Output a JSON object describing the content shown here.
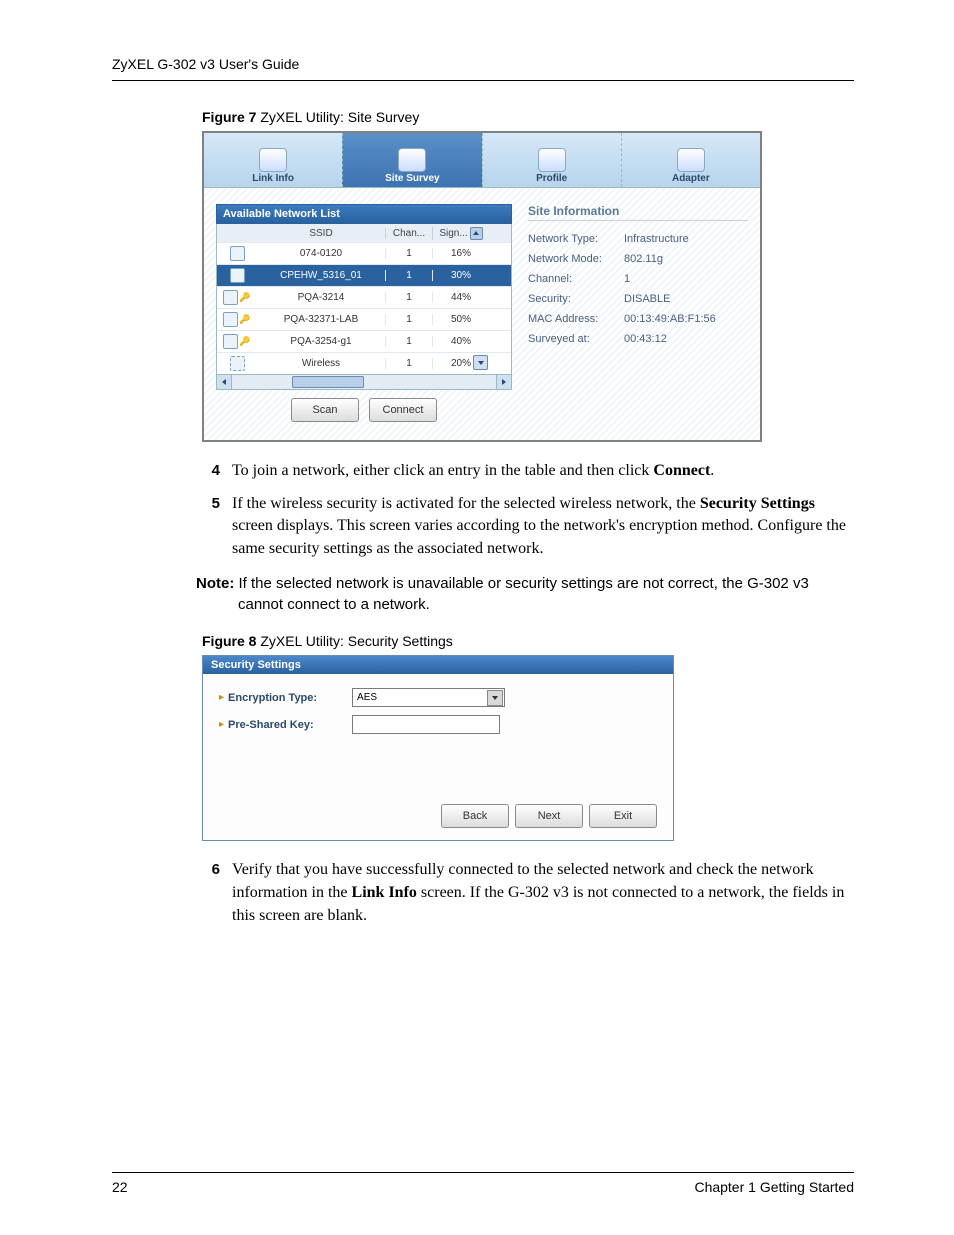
{
  "header": "ZyXEL G-302 v3 User's Guide",
  "figure7": {
    "caption_bold": "Figure 7",
    "caption_rest": "   ZyXEL Utility: Site Survey",
    "tabs": [
      "Link Info",
      "Site Survey",
      "Profile",
      "Adapter"
    ],
    "list_title": "Available Network List",
    "cols": {
      "ssid": "SSID",
      "chan": "Chan...",
      "sig": "Sign..."
    },
    "rows": [
      {
        "ssid": "074-0120",
        "chan": "1",
        "sig": "16%",
        "lock": false,
        "ad": false
      },
      {
        "ssid": "CPEHW_5316_01",
        "chan": "1",
        "sig": "30%",
        "lock": false,
        "ad": false,
        "sel": true
      },
      {
        "ssid": "PQA-3214",
        "chan": "1",
        "sig": "44%",
        "lock": true,
        "ad": false
      },
      {
        "ssid": "PQA-32371-LAB",
        "chan": "1",
        "sig": "50%",
        "lock": true,
        "ad": false
      },
      {
        "ssid": "PQA-3254-g1",
        "chan": "1",
        "sig": "40%",
        "lock": true,
        "ad": false
      },
      {
        "ssid": "Wireless",
        "chan": "1",
        "sig": "20%",
        "lock": false,
        "ad": true
      }
    ],
    "scan": "Scan",
    "connect": "Connect",
    "site_title": "Site Information",
    "site": [
      {
        "l": "Network Type:",
        "v": "Infrastructure"
      },
      {
        "l": "Network Mode:",
        "v": "802.11g"
      },
      {
        "l": "Channel:",
        "v": "1"
      },
      {
        "l": "Security:",
        "v": "DISABLE"
      },
      {
        "l": "MAC Address:",
        "v": "00:13:49:AB:F1:56"
      },
      {
        "l": "Surveyed at:",
        "v": "00:43:12"
      }
    ]
  },
  "steps_a": [
    {
      "n": "4",
      "pre": "To join a network, either click an entry in the table and then click ",
      "bold": "Connect",
      "post": "."
    },
    {
      "n": "5",
      "pre": "If the wireless security is activated for the selected wireless network, the ",
      "bold": "Security Settings",
      "post": " screen displays. This screen varies according to the network's encryption method. Configure the same security settings as the associated network."
    }
  ],
  "note": {
    "prefix": "Note:",
    "text": " If the selected network is unavailable or security settings are not correct, the G-302 v3 cannot connect to a network."
  },
  "figure8": {
    "caption_bold": "Figure 8",
    "caption_rest": "   ZyXEL Utility: Security Settings",
    "title": "Security Settings",
    "enc_label": "Encryption Type:",
    "enc_value": "AES",
    "psk_label": "Pre-Shared Key:",
    "back": "Back",
    "next": "Next",
    "exit": "Exit"
  },
  "steps_b": [
    {
      "n": "6",
      "pre": "Verify that you have successfully connected to the selected network and check the network information in the ",
      "bold": "Link Info",
      "post": " screen. If the G-302 v3 is not connected to a network, the fields in this screen are blank."
    }
  ],
  "footer": {
    "page": "22",
    "chapter": "Chapter 1 Getting Started"
  }
}
